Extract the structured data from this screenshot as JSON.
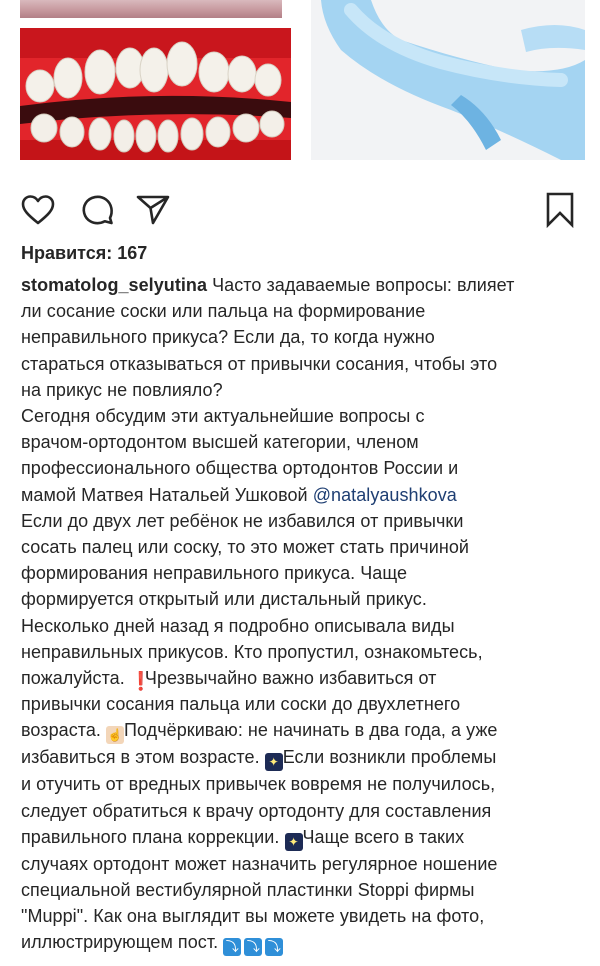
{
  "post": {
    "likes_label": "Нравится: 167",
    "username": "stomatolog_selyutina",
    "caption_lines": [
      "Часто задаваемые вопросы: влияет",
      "ли сосание соски или пальца на формирование",
      "неправильного прикуса? Если да, то когда нужно",
      "стараться отказываться от привычки сосания, чтобы это",
      "на прикус не повлияло?",
      "Сегодня обсудим эти актуальнейшие вопросы с",
      "врачом-ортодонтом высшей категории, членом",
      "профессионального общества ортодонтов России и",
      "мамой Матвея Натальей Ушковой",
      "Если до двух лет ребёнок не избавился от привычки",
      "сосать палец или соску, то это может стать причиной",
      "формирования неправильного прикуса. Чаще",
      "формируется открытый или дистальный прикус.",
      "Несколько дней назад я подробно описывала виды",
      "неправильных прикусов. Кто пропустил, ознакомьтесь,",
      "пожалуйста.",
      "Чрезвычайно важно избавиться от",
      "привычки сосания пальца или соски до двухлетнего",
      "возраста.",
      "Подчёркиваю: не начинать в два года, а уже",
      "избавиться в этом возрасте.",
      "Если возникли проблемы",
      "и отучить от вредных привычек вовремя не получилось,",
      "следует обратиться к врачу ортодонту для составления",
      "правильного плана коррекции.",
      "Чаще всего в таких",
      "случаях ортодонт может назначить регулярное ношение",
      "специальной вестибулярной пластинки Stoppi фирмы",
      "\"Muppi\". Как она выглядит вы можете увидеть на фото,",
      "иллюстрирующем пост."
    ],
    "mention": "@natalyaushkova",
    "emojis": {
      "exclaim": "❗",
      "hand": "☝",
      "night": "✦",
      "down": "⤵"
    }
  },
  "icons": {
    "like": "heart-icon",
    "comment": "comment-icon",
    "share": "paper-plane-icon",
    "save": "bookmark-icon"
  },
  "colors": {
    "text": "#262626",
    "mention": "#1e3e72",
    "icon": "#262626",
    "gums": "#e0242a",
    "plate": "#8cc7ec"
  }
}
